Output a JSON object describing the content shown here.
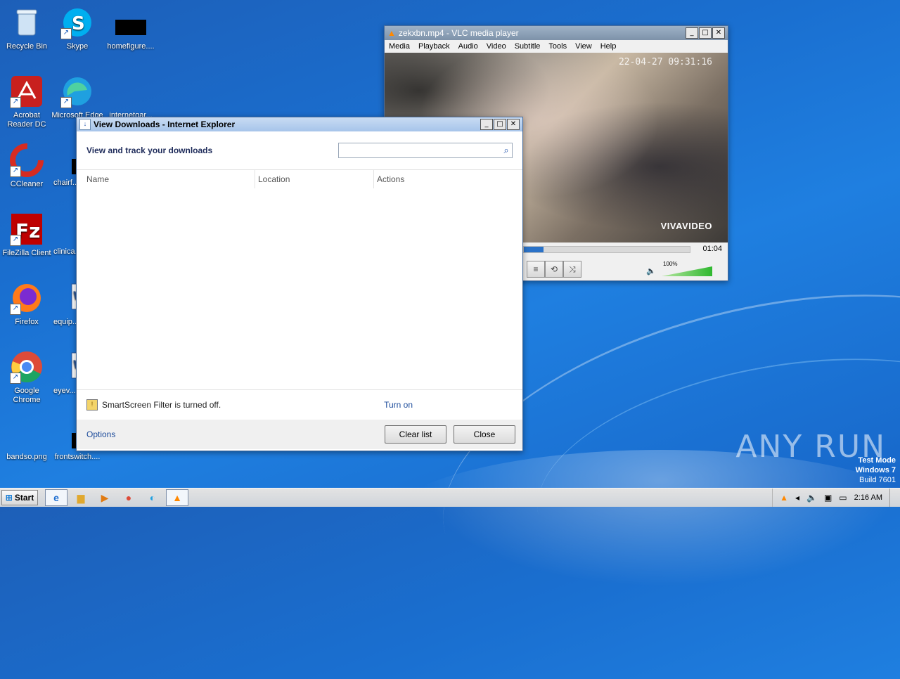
{
  "desktop": {
    "icons": [
      {
        "label": "Recycle Bin",
        "icon": "recycle-bin-icon"
      },
      {
        "label": "Skype",
        "icon": "skype-icon"
      },
      {
        "label": "homefigure....",
        "icon": "image-file-icon"
      },
      {
        "label": "Acrobat Reader DC",
        "icon": "acrobat-icon"
      },
      {
        "label": "Microsoft Edge",
        "icon": "edge-icon"
      },
      {
        "label": "internetgar...",
        "icon": "file-icon"
      },
      {
        "label": "CCleaner",
        "icon": "ccleaner-icon"
      },
      {
        "label": "chairf...",
        "icon": "file-icon"
      },
      {
        "label": "FileZilla Client",
        "icon": "filezilla-icon"
      },
      {
        "label": "clinica...",
        "icon": "file-icon"
      },
      {
        "label": "Firefox",
        "icon": "firefox-icon"
      },
      {
        "label": "equip...",
        "icon": "word-doc-icon"
      },
      {
        "label": "Google Chrome",
        "icon": "chrome-icon"
      },
      {
        "label": "eyev...",
        "icon": "word-doc-icon"
      },
      {
        "label": "bandso.png",
        "icon": "image-file-icon"
      },
      {
        "label": "frontswitch....",
        "icon": "file-icon"
      }
    ],
    "watermark": "ANY RUN",
    "testmode": {
      "line1": "Test Mode",
      "line2": "Windows 7",
      "line3": "Build 7601"
    }
  },
  "ie_dialog": {
    "title": "View Downloads - Internet Explorer",
    "heading": "View and track your downloads",
    "search": {
      "value": "",
      "placeholder": ""
    },
    "columns": [
      "Name",
      "Location",
      "Actions"
    ],
    "smartscreen_text": "SmartScreen Filter is turned off.",
    "turn_on_link": "Turn on",
    "options_link": "Options",
    "clear_list_button": "Clear list",
    "close_button": "Close"
  },
  "vlc": {
    "title": "zekxbn.mp4 - VLC media player",
    "menu": [
      "Media",
      "Playback",
      "Audio",
      "Video",
      "Subtitle",
      "Tools",
      "View",
      "Help"
    ],
    "video_timestamp": "22-04-27 09:31:16",
    "video_watermark": "VIVAVIDEO",
    "time": "01:04",
    "progress": 0.12,
    "volume_label": "100%",
    "volume_level": 1.0
  },
  "taskbar": {
    "start_label": "Start",
    "clock": "2:16 AM",
    "apps": [
      "internet-explorer-icon",
      "explorer-folder-icon",
      "media-player-icon",
      "chrome-icon",
      "edge-icon",
      "vlc-icon"
    ]
  },
  "window_buttons": {
    "minimize": "_",
    "maximize": "□",
    "close": "✕"
  }
}
